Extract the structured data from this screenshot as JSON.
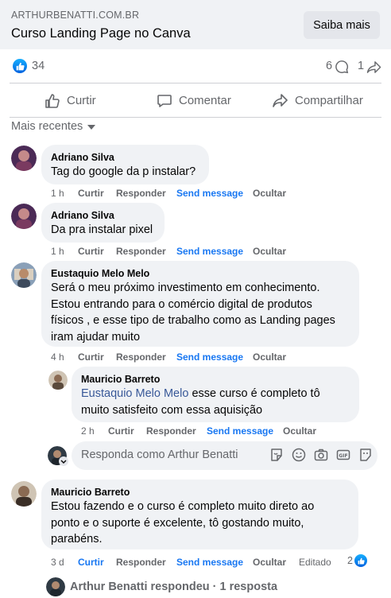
{
  "ad": {
    "domain": "ARTHURBENATTI.COM.BR",
    "title": "Curso Landing Page no Canva",
    "cta_label": "Saiba mais"
  },
  "stats": {
    "likes": "34",
    "comments": "6",
    "shares": "1"
  },
  "actions": {
    "like": "Curtir",
    "comment": "Comentar",
    "share": "Compartilhar"
  },
  "sort_label": "Mais recentes",
  "comments": [
    {
      "author": "Adriano Silva",
      "text": "Tag do google da p instalar?",
      "time": "1 h",
      "like": "Curtir",
      "reply": "Responder",
      "send": "Send message",
      "hide": "Ocultar"
    },
    {
      "author": "Adriano Silva",
      "text": "Da pra instalar pixel",
      "time": "1 h",
      "like": "Curtir",
      "reply": "Responder",
      "send": "Send message",
      "hide": "Ocultar"
    },
    {
      "author": "Eustaquio Melo Melo",
      "text_lines": [
        "Será o meu próximo investimento em conhecimento.",
        "Estou entrando para o comércio digital de produtos",
        "físicos , e esse tipo de trabalho como as Landing pages",
        "iram ajudar muito"
      ],
      "time": "4 h",
      "like": "Curtir",
      "reply": "Responder",
      "send": "Send message",
      "hide": "Ocultar",
      "replies": [
        {
          "author": "Mauricio Barreto",
          "mention": "Eustaquio Melo Melo",
          "text_line1": "esse curso é completo tô",
          "text_line2": "muito satisfeito com essa aquisição",
          "time": "2 h",
          "like": "Curtir",
          "reply": "Responder",
          "send": "Send message",
          "hide": "Ocultar"
        }
      ]
    },
    {
      "author": "Mauricio Barreto",
      "text_lines": [
        "Estou fazendo e o curso é completo muito direto ao",
        "ponto e o suporte é excelente, tô gostando muito,",
        "parabéns."
      ],
      "time": "3 d",
      "like": "Curtir",
      "reply": "Responder",
      "send": "Send message",
      "hide": "Ocultar",
      "edited": "Editado",
      "reaction_count": "2",
      "replies_summary": "Arthur Benatti respondeu · 1 resposta"
    }
  ],
  "reply_box": {
    "placeholder": "Responda como Arthur Benatti",
    "icons": [
      "sticker-icon",
      "emoji-icon",
      "camera-icon",
      "gif-icon",
      "avatar-sticker-icon"
    ]
  },
  "colors": {
    "accent": "#1877f2",
    "bubble": "#f0f2f5",
    "secondary_text": "#65676b"
  }
}
